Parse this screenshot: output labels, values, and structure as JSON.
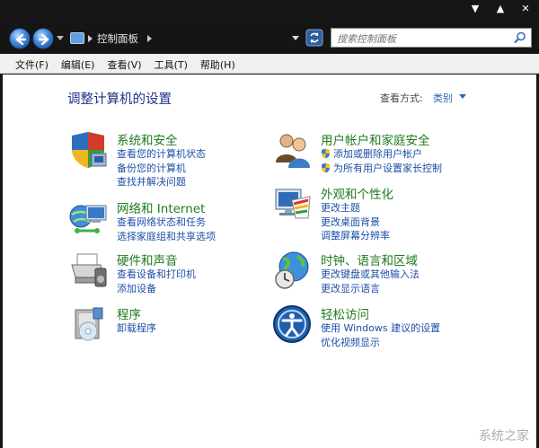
{
  "window": {
    "controls": [
      "▼",
      "▲",
      "✕"
    ]
  },
  "nav": {
    "breadcrumb": "控制面板",
    "search_placeholder": "搜索控制面板"
  },
  "menu": [
    "文件(F)",
    "编辑(E)",
    "查看(V)",
    "工具(T)",
    "帮助(H)"
  ],
  "page": {
    "title": "调整计算机的设置",
    "view_by_label": "查看方式:",
    "view_by_value": "类别"
  },
  "categories": [
    {
      "title": "系统和安全",
      "icon": "shield-icon",
      "links": [
        "查看您的计算机状态",
        "备份您的计算机",
        "查找并解决问题"
      ]
    },
    {
      "title": "网络和 Internet",
      "icon": "network-icon",
      "links": [
        "查看网络状态和任务",
        "选择家庭组和共享选项"
      ]
    },
    {
      "title": "硬件和声音",
      "icon": "printer-icon",
      "links": [
        "查看设备和打印机",
        "添加设备"
      ]
    },
    {
      "title": "程序",
      "icon": "programs-icon",
      "links": [
        "卸载程序"
      ]
    },
    {
      "title": "用户帐户和家庭安全",
      "icon": "users-icon",
      "links": [
        "添加或删除用户帐户",
        "为所有用户设置家长控制"
      ]
    },
    {
      "title": "外观和个性化",
      "icon": "monitor-icon",
      "links": [
        "更改主题",
        "更改桌面背景",
        "调整屏幕分辨率"
      ]
    },
    {
      "title": "时钟、语言和区域",
      "icon": "globe-clock-icon",
      "links": [
        "更改键盘或其他输入法",
        "更改显示语言"
      ]
    },
    {
      "title": "轻松访问",
      "icon": "accessibility-icon",
      "links": [
        "使用 Windows 建议的设置",
        "优化视频显示"
      ]
    }
  ],
  "watermark": "系统之家"
}
